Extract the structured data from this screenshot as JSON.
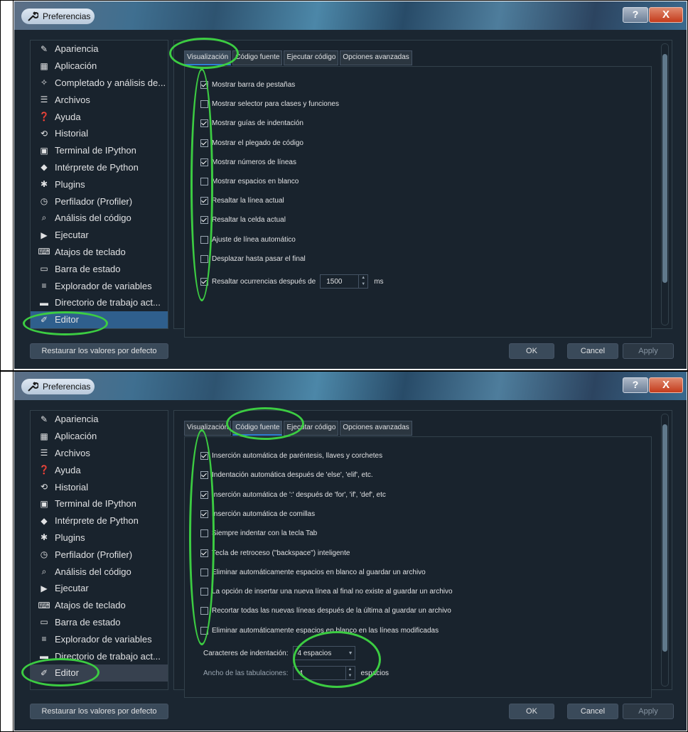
{
  "window": {
    "title": "Preferencias",
    "help_label": "?",
    "close_label": "X"
  },
  "sidebar_top": [
    "Apariencia",
    "Aplicación",
    "Completado y análisis de...",
    "Archivos",
    "Ayuda",
    "Historial",
    "Terminal de IPython",
    "Intérprete de Python",
    "Plugins",
    "Perfilador (Profiler)",
    "Análisis del código",
    "Ejecutar",
    "Atajos de teclado",
    "Barra de estado",
    "Explorador de variables",
    "Directorio de trabajo act...",
    "Editor"
  ],
  "sidebar_bottom": [
    "Apariencia",
    "Aplicación",
    "Archivos",
    "Ayuda",
    "Historial",
    "Terminal de IPython",
    "Intérprete de Python",
    "Plugins",
    "Perfilador (Profiler)",
    "Análisis del código",
    "Ejecutar",
    "Atajos de teclado",
    "Barra de estado",
    "Explorador de variables",
    "Directorio de trabajo act...",
    "Editor"
  ],
  "tabs": [
    "Visualización",
    "Código fuente",
    "Ejecutar código",
    "Opciones avanzadas"
  ],
  "panel1_options": [
    {
      "label": "Mostrar barra de pestañas",
      "checked": true
    },
    {
      "label": "Mostrar selector para clases y funciones",
      "checked": false
    },
    {
      "label": "Mostrar guías de indentación",
      "checked": true
    },
    {
      "label": "Mostrar el plegado de código",
      "checked": true
    },
    {
      "label": "Mostrar números de líneas",
      "checked": true
    },
    {
      "label": "Mostrar espacios en blanco",
      "checked": false
    },
    {
      "label": "Resaltar la línea actual",
      "checked": true
    },
    {
      "label": "Resaltar la celda actual",
      "checked": true
    },
    {
      "label": "Ajuste de línea automático",
      "checked": false
    },
    {
      "label": "Desplazar hasta pasar el final",
      "checked": false
    },
    {
      "label": "Resaltar ocurrencias después de",
      "checked": true
    }
  ],
  "panel1_spin": {
    "value": "1500",
    "unit": "ms"
  },
  "panel2_options": [
    {
      "label": "Inserción automática de paréntesis, llaves y corchetes",
      "checked": true
    },
    {
      "label": "Indentación automática después de 'else', 'elif', etc.",
      "checked": true
    },
    {
      "label": "Inserción automática de ':' después de 'for', 'if', 'def', etc",
      "checked": true
    },
    {
      "label": "Inserción automática de comillas",
      "checked": true
    },
    {
      "label": "Siempre indentar con la tecla Tab",
      "checked": false
    },
    {
      "label": "Tecla de retroceso (\"backspace\") inteligente",
      "checked": true
    },
    {
      "label": "Eliminar automáticamente espacios en blanco al guardar un archivo",
      "checked": false
    },
    {
      "label": "La opción de insertar una nueva línea al final no existe al guardar un archivo",
      "checked": false
    },
    {
      "label": "Recortar todas las nuevas líneas después de la última al guardar un archivo",
      "checked": false
    },
    {
      "label": "Eliminar automáticamente espacios en blanco en las líneas modificadas",
      "checked": false
    }
  ],
  "indent_chars": {
    "label": "Caracteres de indentación:",
    "value": "4 espacios"
  },
  "tab_width": {
    "label": "Ancho de las tabulaciones:",
    "value": "4",
    "unit": "espacios"
  },
  "buttons": {
    "restore": "Restaurar los valores por defecto",
    "ok": "OK",
    "cancel": "Cancel",
    "apply": "Apply"
  },
  "icons": {
    "Apariencia": "edit-icon",
    "Aplicación": "window-icon",
    "Completado y análisis de...": "completion-icon",
    "Archivos": "files-icon",
    "Ayuda": "help-icon",
    "Historial": "history-icon",
    "Terminal de IPython": "terminal-icon",
    "Intérprete de Python": "python-icon",
    "Plugins": "puzzle-icon",
    "Perfilador (Profiler)": "stopwatch-icon",
    "Análisis del código": "search-check-icon",
    "Ejecutar": "play-icon",
    "Atajos de teclado": "keyboard-icon",
    "Barra de estado": "statusbar-icon",
    "Explorador de variables": "list-icon",
    "Directorio de trabajo act...": "folder-icon",
    "Editor": "pencil-icon"
  },
  "colors": {
    "background": "#19232d",
    "selection_top": "#2f5f8d",
    "annotation_ring": "#3ccc42",
    "accent": "#2f7fd6"
  }
}
